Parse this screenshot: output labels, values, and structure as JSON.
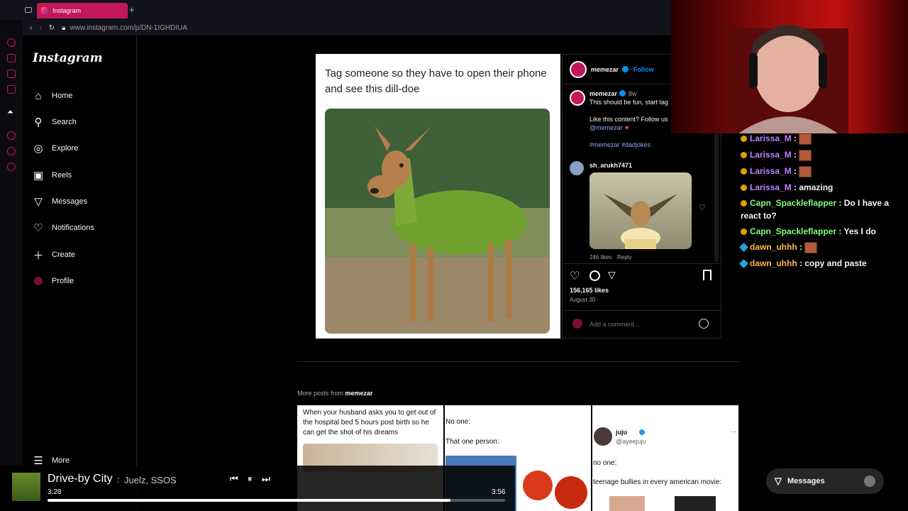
{
  "browser": {
    "tab_title": "Instagram",
    "new_tab": "+",
    "url": "www.instagram.com/p/DN-1IGHDIUA"
  },
  "sidebar": {
    "logo": "Instagram",
    "items": [
      {
        "label": "Home",
        "icon": "home-icon"
      },
      {
        "label": "Search",
        "icon": "search-icon"
      },
      {
        "label": "Explore",
        "icon": "compass-icon"
      },
      {
        "label": "Reels",
        "icon": "reels-icon"
      },
      {
        "label": "Messages",
        "icon": "send-icon"
      },
      {
        "label": "Notifications",
        "icon": "heart-icon"
      },
      {
        "label": "Create",
        "icon": "plus-icon"
      },
      {
        "label": "Profile",
        "icon": "avatar-icon"
      }
    ],
    "more": "More"
  },
  "post": {
    "image_text": "Tag someone so they have to open their phone and see this dill-doe",
    "author": "memezar",
    "follow": "Follow",
    "caption": {
      "author": "memezar",
      "time": "8w",
      "line1": "This should be fun, start tag",
      "line2": "Like this content? Follow us",
      "mention": "@memezar",
      "hashtags": "#memezar #dadjokes"
    },
    "comment": {
      "author": "sh_arukh7471",
      "likes": "246 likes",
      "reply": "Reply"
    },
    "likes": "156,165 likes",
    "date": "August 30",
    "add_comment_placeholder": "Add a comment..."
  },
  "more_posts": {
    "prefix": "More posts from ",
    "author": "memezar",
    "tiles": [
      {
        "text": "When your husband asks you to get out of the hospital bed 5 hours post birth so he can get the shot of his dreams"
      },
      {
        "line1": "No one:",
        "line2": "That one person:"
      },
      {
        "name": "juju",
        "handle": "@ayeejuju",
        "line1": "no one:",
        "line2": "teenage bullies in every american movie:",
        "menu": "···"
      }
    ]
  },
  "chat": [
    {
      "user": "Larissa_M",
      "text": "",
      "color": "#c77dff",
      "emote": true,
      "badge": "gold"
    },
    {
      "user": "Larissa_M",
      "text": "",
      "color": "#c77dff",
      "emote": true,
      "badge": "gold"
    },
    {
      "user": "Larissa_M",
      "text": "",
      "color": "#c77dff",
      "emote": true,
      "badge": "gold"
    },
    {
      "user": "Larissa_M",
      "text": "amazing",
      "color": "#c77dff",
      "emote": false,
      "badge": "gold"
    },
    {
      "user": "Capn_Spackleflapper",
      "text": "Do I have a react to?",
      "color": "#7dff7d",
      "emote": false,
      "badge": "gold"
    },
    {
      "user": "Capn_Spackleflapper",
      "text": "Yes I do",
      "color": "#7dff7d",
      "emote": false,
      "badge": "gold"
    },
    {
      "user": "dawn_uhhh",
      "text": "",
      "color": "#ffb84d",
      "emote": true,
      "badge": "blue"
    },
    {
      "user": "dawn_uhhh",
      "text": "copy and paste",
      "color": "#ffb84d",
      "emote": false,
      "badge": "blue"
    }
  ],
  "messages_button": "Messages",
  "player": {
    "title": "Drive-by City",
    "separator": ":",
    "artist": "Juelz, SSOS",
    "elapsed": "3:28",
    "total": "3:56",
    "progress": 0.88
  }
}
